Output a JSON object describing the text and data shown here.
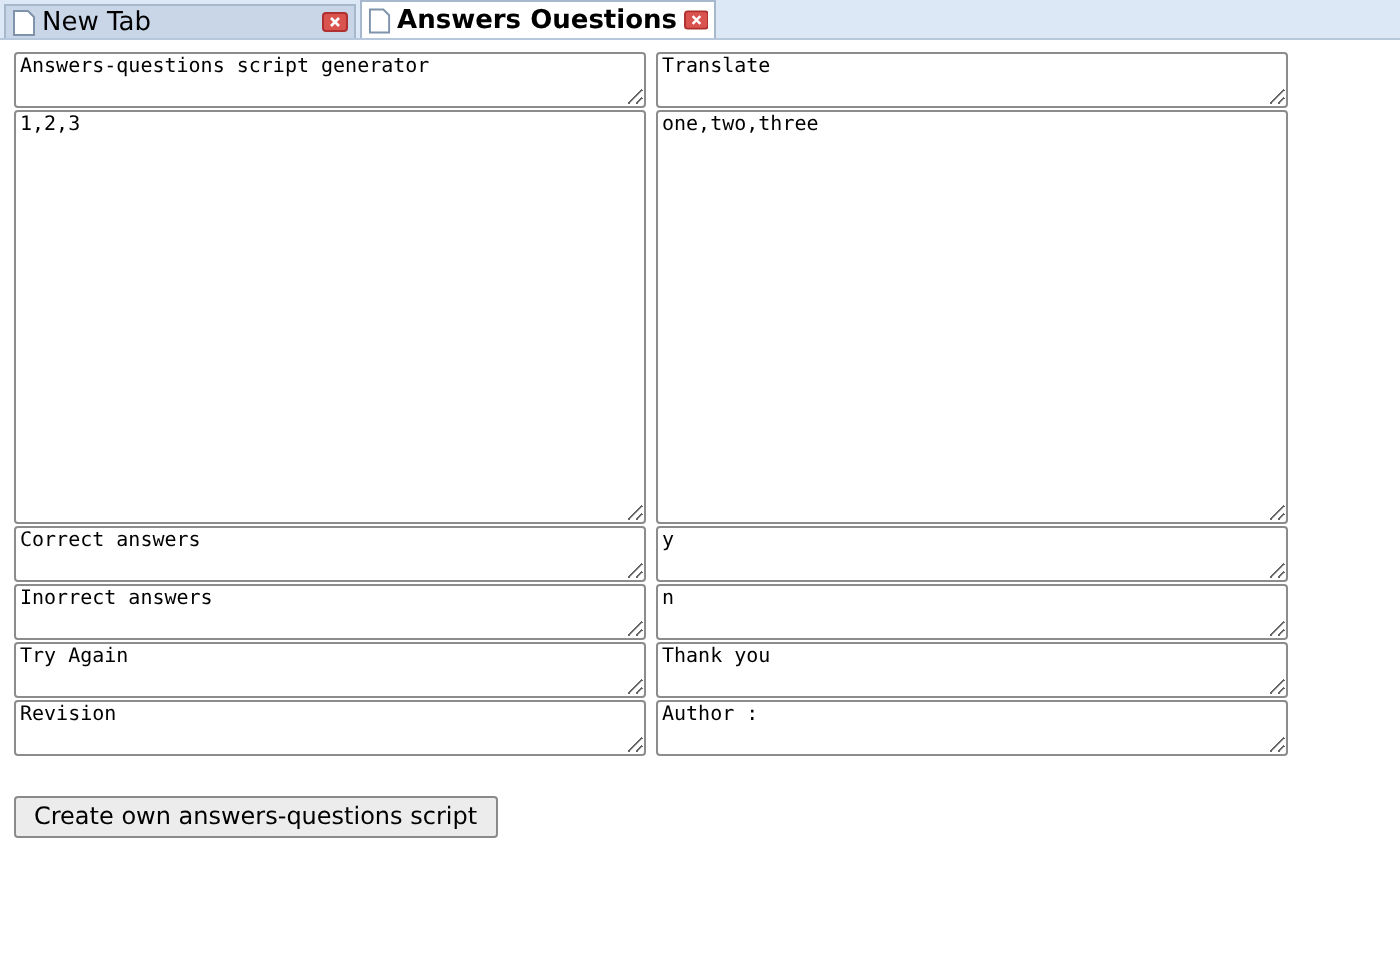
{
  "tabs": [
    {
      "label": "New Tab",
      "selected": false
    },
    {
      "label": "Answers Ouestions",
      "selected": true
    }
  ],
  "rows": [
    {
      "kind": "short",
      "cells": [
        "Answers-questions script generator",
        "Translate"
      ]
    },
    {
      "kind": "tall",
      "cells": [
        "1,2,3",
        "one,two,three"
      ]
    },
    {
      "kind": "short",
      "cells": [
        "Correct answers",
        "y"
      ]
    },
    {
      "kind": "short",
      "cells": [
        "Inorrect answers",
        "n"
      ]
    },
    {
      "kind": "short",
      "cells": [
        "Try Again",
        "Thank you"
      ]
    },
    {
      "kind": "short",
      "cells": [
        "Revision",
        "Author :"
      ]
    }
  ],
  "button": "Create own answers-questions script"
}
